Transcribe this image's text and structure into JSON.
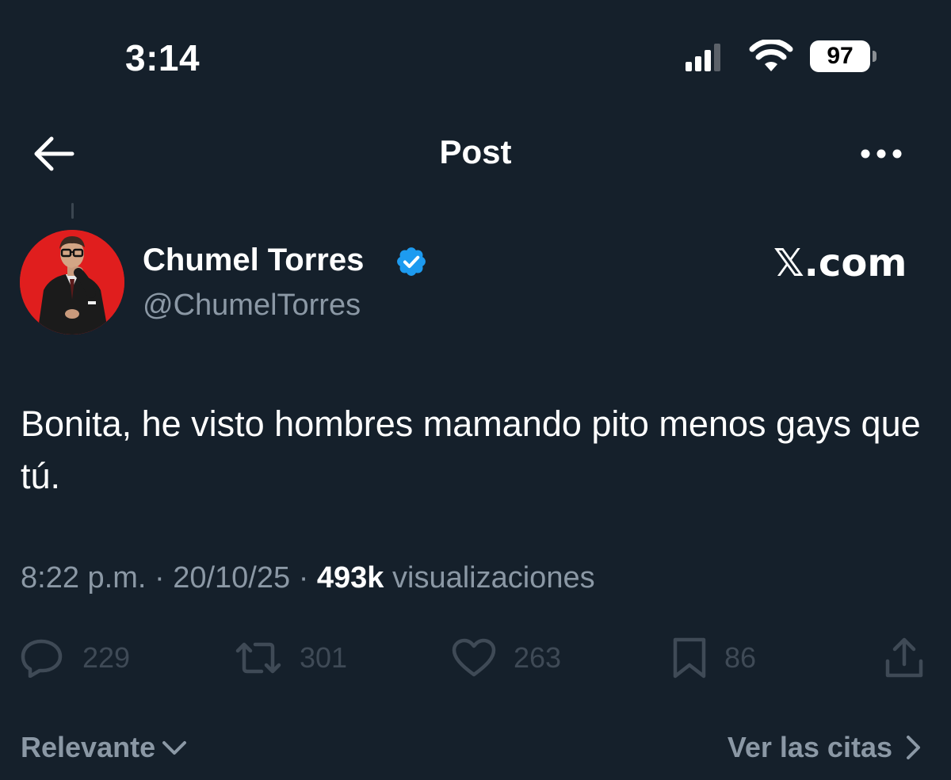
{
  "status_bar": {
    "time": "3:14",
    "battery": "97"
  },
  "header": {
    "title": "Post"
  },
  "author": {
    "name": "Chumel Torres",
    "handle": "@ChumelTorres",
    "verified": true
  },
  "source_mark": "𝕏.com",
  "tweet": {
    "text": "Bonita, he visto hombres mamando pito menos gays que tú.",
    "time": "8:22 p.m.",
    "date": "20/10/25",
    "views_count": "493k",
    "views_label": "visualizaciones"
  },
  "actions": {
    "replies": "229",
    "reposts": "301",
    "likes": "263",
    "bookmarks": "86"
  },
  "footer": {
    "sort_label": "Relevante",
    "quotes_label": "Ver las citas"
  },
  "colors": {
    "background": "#15202b",
    "verified_badge": "#1d9bf0",
    "avatar_bg": "#e01e1e"
  },
  "icons": [
    "back-arrow-icon",
    "more-icon",
    "verified-icon",
    "reply-icon",
    "repost-icon",
    "like-icon",
    "bookmark-icon",
    "share-icon",
    "chevron-down-icon",
    "chevron-right-icon",
    "signal-icon",
    "wifi-icon",
    "battery-icon"
  ]
}
